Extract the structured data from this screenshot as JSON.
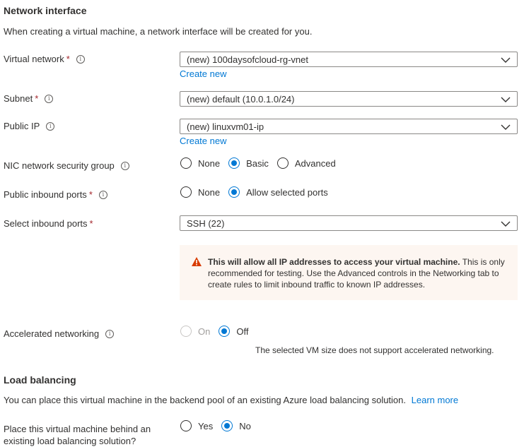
{
  "network_interface": {
    "title": "Network interface",
    "description": "When creating a virtual machine, a network interface will be created for you."
  },
  "virtual_network": {
    "label": "Virtual network",
    "required_mark": "*",
    "info_icon": "info-icon",
    "value": "(new) 100daysofcloud-rg-vnet",
    "create_new": "Create new"
  },
  "subnet": {
    "label": "Subnet",
    "required_mark": "*",
    "value": "(new) default (10.0.1.0/24)"
  },
  "public_ip": {
    "label": "Public IP",
    "value": "(new) linuxvm01-ip",
    "create_new": "Create new"
  },
  "nic_nsg": {
    "label": "NIC network security group",
    "options": [
      "None",
      "Basic",
      "Advanced"
    ],
    "selected": "Basic"
  },
  "public_inbound_ports": {
    "label": "Public inbound ports",
    "required_mark": "*",
    "options": [
      "None",
      "Allow selected ports"
    ],
    "selected": "Allow selected ports"
  },
  "select_inbound_ports": {
    "label": "Select inbound ports",
    "required_mark": "*",
    "value": "SSH (22)"
  },
  "warning": {
    "icon": "warning-icon",
    "color": "#d83b01",
    "strong": "This will allow all IP addresses to access your virtual machine.",
    "text": "This is only recommended for testing.  Use the Advanced controls in the Networking tab to create rules to limit inbound traffic to known IP addresses."
  },
  "accelerated_networking": {
    "label": "Accelerated networking",
    "options": [
      "On",
      "Off"
    ],
    "selected": "Off",
    "on_disabled": true,
    "note": "The selected VM size does not support accelerated networking."
  },
  "load_balancing": {
    "title": "Load balancing",
    "description": "You can place this virtual machine in the backend pool of an existing Azure load balancing solution.",
    "learn_more": "Learn more",
    "question_line1": "Place this virtual machine behind an",
    "question_line2": "existing load balancing solution?",
    "options": [
      "Yes",
      "No"
    ],
    "selected": "No"
  },
  "colors": {
    "accent": "#0078d4",
    "required": "#a4262c",
    "warning_bg": "#fdf6f1"
  }
}
